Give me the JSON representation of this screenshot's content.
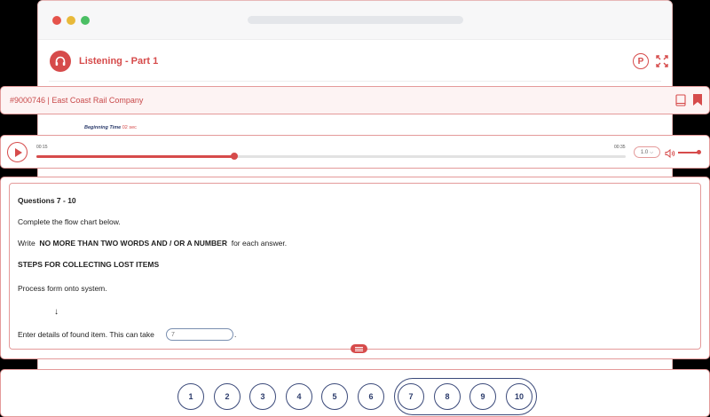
{
  "app": {
    "title": "Listening - Part 1",
    "p_label": "P"
  },
  "test": {
    "title": "#9000746 | East Coast Rail Company"
  },
  "timing": {
    "label": "Beginning Time",
    "value": "02 sec"
  },
  "audio": {
    "current_time": "00:15",
    "total_time": "00:35",
    "progress": 0.336,
    "speed": "1.0"
  },
  "questions": {
    "heading": "Questions 7 - 10",
    "instruction": "Complete the flow chart below.",
    "write_prefix": "Write",
    "write_bold": "NO MORE THAN TWO WORDS AND / OR A NUMBER",
    "write_suffix": "for each answer.",
    "section_title": "STEPS FOR COLLECTING LOST ITEMS",
    "step1": "Process form onto system.",
    "arrow": "↓",
    "step2": "Enter details of found item. This can take",
    "answer_placeholder": "7",
    "step2_end": "."
  },
  "nav": {
    "numbers": [
      "1",
      "2",
      "3",
      "4",
      "5",
      "6",
      "7",
      "8",
      "9",
      "10"
    ]
  },
  "colors": {
    "accent": "#d64b4b",
    "navy": "#2b3b6b"
  }
}
